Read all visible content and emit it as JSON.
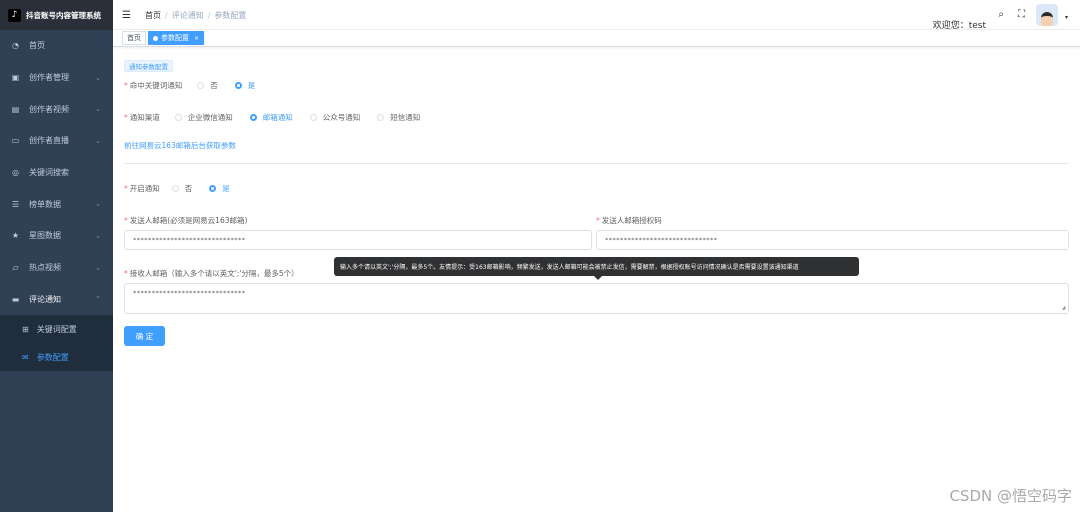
{
  "app": {
    "title": "抖音账号内容管理系统",
    "logo_glyph": "♪"
  },
  "sidebar": {
    "items": [
      {
        "label": "首页",
        "icon": "dashboard-icon",
        "glyph": "◔",
        "has_children": false
      },
      {
        "label": "创作者管理",
        "icon": "creator-icon",
        "glyph": "▣",
        "has_children": true
      },
      {
        "label": "创作者视频",
        "icon": "video-icon",
        "glyph": "▤",
        "has_children": true
      },
      {
        "label": "创作者直播",
        "icon": "live-icon",
        "glyph": "▭",
        "has_children": true
      },
      {
        "label": "关键词搜索",
        "icon": "search-icon",
        "glyph": "◎",
        "has_children": false
      },
      {
        "label": "榜单数据",
        "icon": "list-icon",
        "glyph": "☰",
        "has_children": true
      },
      {
        "label": "星图数据",
        "icon": "star-icon",
        "glyph": "★",
        "has_children": true
      },
      {
        "label": "热点视频",
        "icon": "hot-video-icon",
        "glyph": "▱",
        "has_children": true
      },
      {
        "label": "评论通知",
        "icon": "comment-icon",
        "glyph": "▬",
        "has_children": true,
        "open": true
      }
    ],
    "sub_items": [
      {
        "label": "关键词配置",
        "glyph": "⊞",
        "active": false
      },
      {
        "label": "参数配置",
        "glyph": "✉",
        "active": true
      }
    ],
    "chevron_down": "⌄",
    "chevron_up": "⌃"
  },
  "header": {
    "hamburger": "☰",
    "breadcrumb": [
      "首页",
      "评论通知",
      "参数配置"
    ],
    "welcome": "欢迎您：test",
    "search_glyph": "⌕",
    "fullscreen_glyph": "⛶",
    "caret": "▾"
  },
  "tags": [
    {
      "label": "首页",
      "active": false
    },
    {
      "label": "参数配置",
      "active": true,
      "close": "×"
    }
  ],
  "form": {
    "section_title": "通知参数配置",
    "keyword_notice": {
      "label": "命中关键词通知",
      "options": [
        "否",
        "是"
      ],
      "selected": "是"
    },
    "channel": {
      "label": "通知渠道",
      "options": [
        "企业微信通知",
        "邮箱通知",
        "公众号通知",
        "短信通知"
      ],
      "selected": "邮箱通知"
    },
    "link_text": "前往网易云163邮箱后台获取参数",
    "enable_notice": {
      "label": "开启通知",
      "options": [
        "否",
        "是"
      ],
      "selected": "是"
    },
    "sender_email": {
      "label": "发送人邮箱(必须是网易云163邮箱)",
      "value": "******************************"
    },
    "sender_auth": {
      "label": "发送人邮箱授权码",
      "value": "******************************"
    },
    "receiver_email": {
      "label": "接收人邮箱（输入多个请以英文';'分隔，最多5个）",
      "value": "******************************"
    },
    "tooltip": "输入多个请以英文';'分隔，最多5个。友情提示：受163邮箱影响，频繁发送，发送人邮箱可能会被禁止发信，需要解禁，根据授权账号访问情况确认是否需要设置该通知渠道",
    "submit_label": "确 定",
    "required_mark": "*"
  },
  "watermark": "CSDN @悟空码字"
}
